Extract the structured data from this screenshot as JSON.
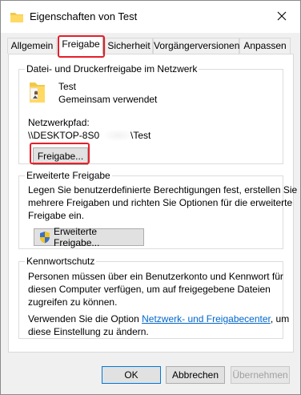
{
  "window": {
    "title": "Eigenschaften von Test",
    "close_symbol": "✕"
  },
  "tabs": [
    {
      "label": "Allgemein",
      "active": false
    },
    {
      "label": "Freigabe",
      "active": true
    },
    {
      "label": "Sicherheit",
      "active": false
    },
    {
      "label": "Vorgängerversionen",
      "active": false
    },
    {
      "label": "Anpassen",
      "active": false
    }
  ],
  "network_sharing": {
    "title": "Datei- und Druckerfreigabe im Netzwerk",
    "folder_name": "Test",
    "folder_status": "Gemeinsam verwendet",
    "path_label": "Netzwerkpfad:",
    "path_prefix": "\\\\DESKTOP-8S0",
    "path_suffix": "\\Test",
    "share_button": "Freigabe..."
  },
  "advanced_sharing": {
    "title": "Erweiterte Freigabe",
    "description_lines": [
      "Legen Sie benutzerdefinierte Berechtigungen fest, erstellen Sie",
      "mehrere Freigaben und richten Sie Optionen für die erweiterte",
      "Freigabe ein."
    ],
    "button": "Erweiterte Freigabe..."
  },
  "password_protection": {
    "title": "Kennwortschutz",
    "description_lines": [
      "Personen müssen über ein Benutzerkonto und Kennwort für",
      "diesen Computer verfügen, um auf freigegebene Dateien",
      "zugreifen zu können."
    ],
    "change_prefix": "Verwenden Sie die Option ",
    "change_link": "Netzwerk- und Freigabecenter",
    "change_suffix": ", um",
    "change_line2": "diese Einstellung zu ändern."
  },
  "footer": {
    "ok": "OK",
    "cancel": "Abbrechen",
    "apply": "Übernehmen"
  },
  "colors": {
    "highlight": "#e4202a",
    "link": "#0066cc",
    "folder": "#f2c84b"
  }
}
